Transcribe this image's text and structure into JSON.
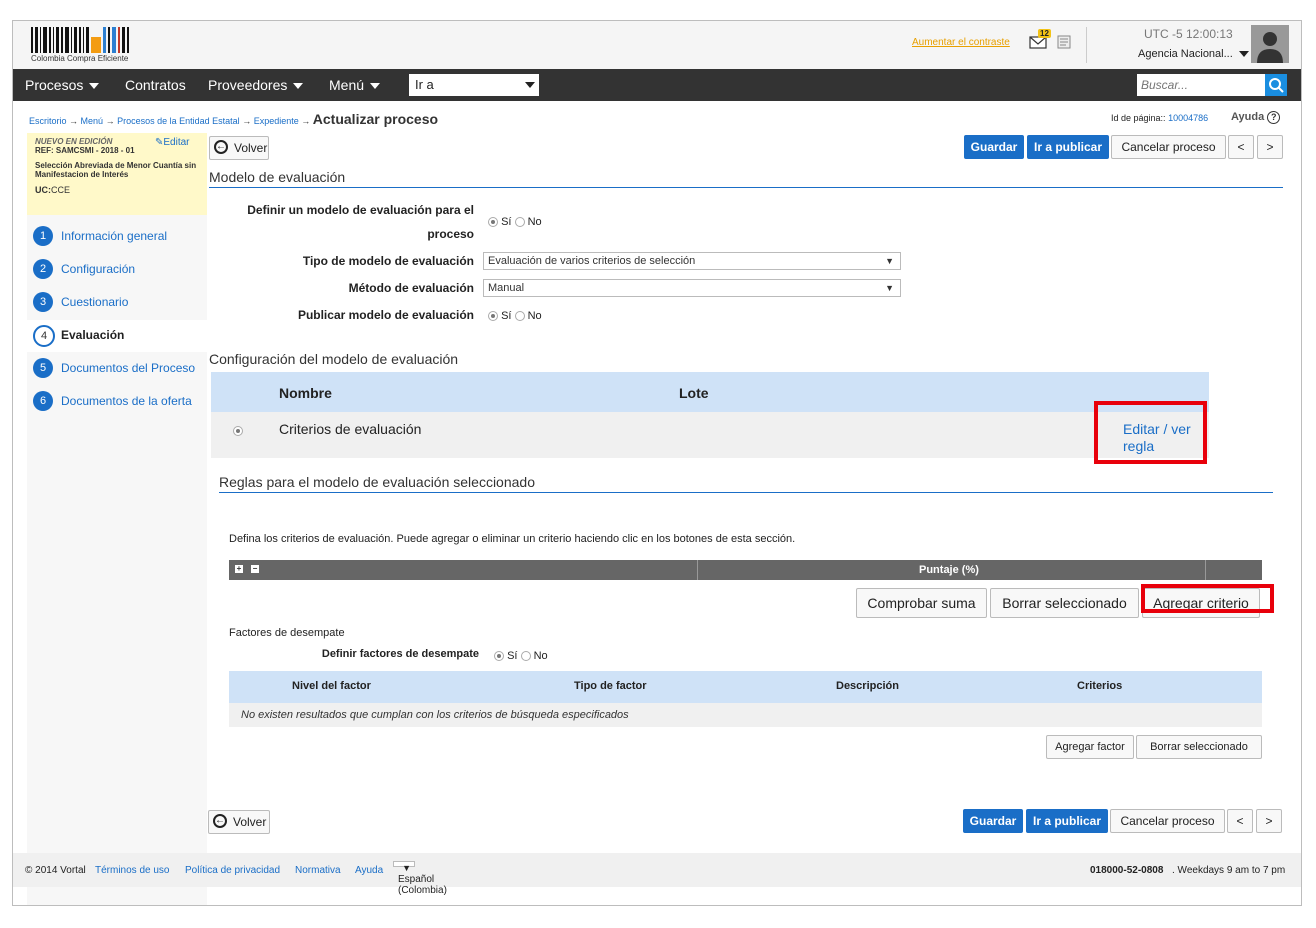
{
  "header": {
    "brand": "Colombia Compra Eficiente",
    "contrast_link": "Aumentar el contraste",
    "mail_count": "12",
    "time": "UTC -5 12:00:13",
    "agency": "Agencia Nacional..."
  },
  "nav": {
    "procesos": "Procesos",
    "contratos": "Contratos",
    "proveedores": "Proveedores",
    "menu": "Menú",
    "ir_a": "Ir a",
    "search_placeholder": "Buscar..."
  },
  "breadcrumb": {
    "items": [
      "Escritorio",
      "Menú",
      "Procesos de la Entidad Estatal",
      "Expediente"
    ],
    "current": "Actualizar proceso",
    "arrow": "→",
    "page_id_label": "Id de página::",
    "page_id": "10004786",
    "help": "Ayuda"
  },
  "sidebar": {
    "status": "NUEVO EN EDICIÓN",
    "edit": "Editar",
    "ref": "REF: SAMCSMI - 2018 - 01",
    "desc": "Selección Abreviada de Menor Cuantía sin Manifestacion de Interés",
    "uc_label": "UC:",
    "uc_value": "CCE",
    "steps": [
      {
        "num": "1",
        "label": "Información general"
      },
      {
        "num": "2",
        "label": "Configuración"
      },
      {
        "num": "3",
        "label": "Cuestionario"
      },
      {
        "num": "4",
        "label": "Evaluación"
      },
      {
        "num": "5",
        "label": "Documentos del Proceso"
      },
      {
        "num": "6",
        "label": "Documentos de la oferta"
      }
    ]
  },
  "toolbar": {
    "back": "Volver",
    "save": "Guardar",
    "publish": "Ir a publicar",
    "cancel": "Cancelar proceso",
    "prev": "<",
    "next": ">"
  },
  "model": {
    "title": "Modelo de evaluación",
    "define_label_1": "Definir un modelo de evaluación para el",
    "define_label_2": "proceso",
    "yes": "Sí",
    "no": "No",
    "type_label": "Tipo de modelo de evaluación",
    "type_value": "Evaluación de varios criterios de selección",
    "method_label": "Método de evaluación",
    "method_value": "Manual",
    "publish_label": "Publicar modelo de evaluación"
  },
  "config": {
    "title": "Configuración del modelo de evaluación",
    "col_name": "Nombre",
    "col_lot": "Lote",
    "row_name": "Criterios de evaluación",
    "edit_link_1": "Editar / ver",
    "edit_link_2": "regla"
  },
  "rules": {
    "title": "Reglas para el modelo de evaluación seleccionado",
    "instructions": "Defina los criterios de evaluación. Puede agregar o eliminar un criterio haciendo clic en los botones de esta sección.",
    "score_header": "Puntaje (%)",
    "check_sum": "Comprobar suma",
    "delete_selected": "Borrar seleccionado",
    "add_criterion": "Agregar criterio"
  },
  "tiebreak": {
    "title": "Factores de desempate",
    "define_label": "Definir factores de desempate",
    "col_level": "Nivel del factor",
    "col_type": "Tipo de factor",
    "col_desc": "Descripción",
    "col_criteria": "Criterios",
    "empty": "No existen resultados que cumplan con los criterios de búsqueda especificados",
    "add_factor": "Agregar factor",
    "delete_selected": "Borrar seleccionado"
  },
  "footer": {
    "copyright": "© 2014 Vortal",
    "terms": "Términos de uso",
    "privacy": "Política de privacidad",
    "rules": "Normativa",
    "help": "Ayuda",
    "language": "Español (Colombia)",
    "phone": "018000-52-0808",
    "hours": ". Weekdays 9 am to 7 pm"
  },
  "colors": {
    "accent": "#1a6ec7",
    "highlight": "#e8000b",
    "nav": "#333333"
  }
}
